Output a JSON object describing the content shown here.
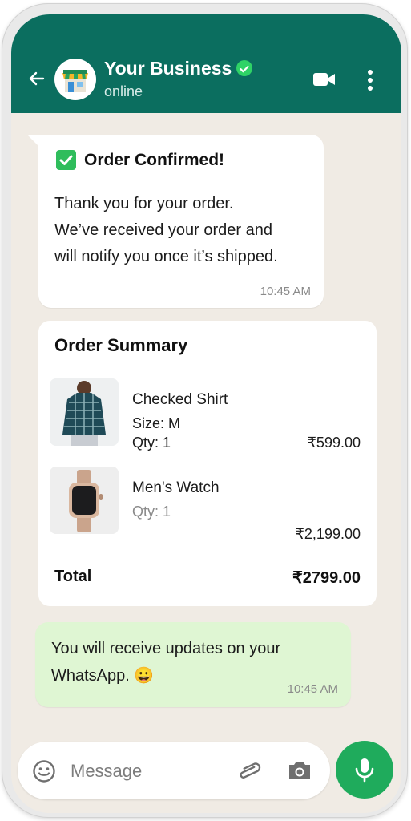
{
  "header": {
    "title": "Your Business",
    "status": "online",
    "background": "#0b6e5f"
  },
  "messages": {
    "confirmation": {
      "title": "Order Confirmed!",
      "line1": "Thank you for your order.",
      "line2": "We’ve received your order and",
      "line3": "will notify you once it’s shipped.",
      "time": "10:45 AM"
    },
    "summary": {
      "title": "Order Summary",
      "items": [
        {
          "name": "Checked Shirt",
          "size": "Size: M",
          "qty": "Qty: 1",
          "price": "₹599.00"
        },
        {
          "name": "Men's Watch",
          "qty": "Qty: 1",
          "price": "₹2,199.00"
        }
      ],
      "total_label": "Total",
      "total_value": "₹2799.00"
    },
    "update": {
      "line1": "You will receive updates on your",
      "line2": "WhatsApp. 😀",
      "time": "10:45 AM",
      "background": "#dff6d3"
    }
  },
  "composer": {
    "placeholder": "Message"
  },
  "icons": [
    "back-arrow-icon",
    "store-icon",
    "verified-icon",
    "video-call-icon",
    "more-icon",
    "check-icon",
    "emoji-icon",
    "attach-icon",
    "camera-icon",
    "mic-icon"
  ],
  "colors": {
    "accent": "#1fab5c",
    "verified": "#2fd366"
  }
}
